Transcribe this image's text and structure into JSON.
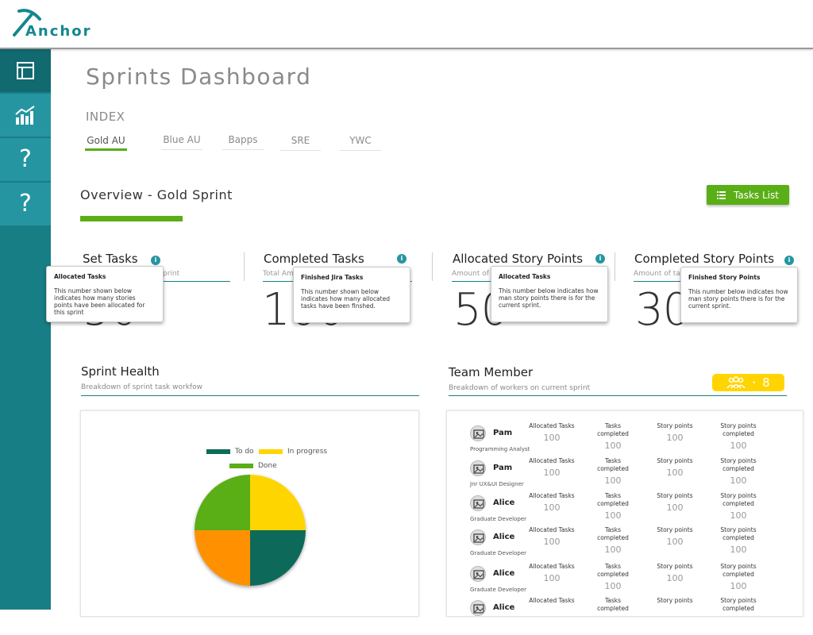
{
  "brand": {
    "name": "Anchor",
    "color": "#14878f"
  },
  "sidebar": {
    "items": [
      {
        "icon": "dashboard-icon",
        "active": true
      },
      {
        "icon": "bar-chart-icon",
        "active": false
      },
      {
        "icon": "help-icon",
        "label": "?"
      },
      {
        "icon": "help-icon",
        "label": "?"
      }
    ]
  },
  "page": {
    "title": "Sprints Dashboard"
  },
  "index": {
    "label": "INDEX",
    "tabs": [
      "Gold AU",
      "Blue AU",
      "Bapps",
      "SRE",
      "YWC"
    ],
    "active": "Gold AU"
  },
  "overview": {
    "title": "Overview - Gold Sprint",
    "tasks_button": "Tasks List"
  },
  "stats": [
    {
      "title": "Set Tasks",
      "sub": "print",
      "value": "50"
    },
    {
      "title": "Completed Tasks",
      "sub": "Total Am",
      "value": "100"
    },
    {
      "title": "Allocated Story Points",
      "sub": "Amount of",
      "value": "50"
    },
    {
      "title": "Completed Story Points",
      "sub": "Amount of ta",
      "value": "30"
    }
  ],
  "tooltips": [
    {
      "title": "Allocated Tasks",
      "body": "This number shown below indicates how many stories points have been allocated for this sprint"
    },
    {
      "title": "Finished Jira Tasks",
      "body": "This number shown below indicates how many allocated tasks have been finshed."
    },
    {
      "title": "Allocated Tasks",
      "body": "This number below indicates how man story points there is for the current sprint."
    },
    {
      "title": "Finished Story Points",
      "body": "This number below indicates how man story points there is for the current sprint."
    }
  ],
  "sprint_health": {
    "title": "Sprint Health",
    "subtitle": "Breakdown of sprint  task workfow",
    "legend": [
      {
        "label": "To do",
        "color": "#0e6b5a"
      },
      {
        "label": "In progress",
        "color": "#ffd500"
      },
      {
        "label": "Done",
        "color": "#5aae16"
      }
    ]
  },
  "chart_data": {
    "type": "pie",
    "slices": [
      {
        "label": "In progress",
        "value": 25,
        "color": "#ffd500"
      },
      {
        "label": "To do",
        "value": 25,
        "color": "#0e6b5a"
      },
      {
        "label": "",
        "value": 25,
        "color": "#ff9100"
      },
      {
        "label": "Done",
        "value": 25,
        "color": "#5aae16"
      }
    ],
    "legend_position": "top"
  },
  "team": {
    "title": "Team Member",
    "subtitle": "Breakdown of workers on current sprint",
    "count": "8",
    "columns": [
      "Allocated Tasks",
      "Tasks completed",
      "Story points",
      "Story points completed"
    ],
    "members": [
      {
        "name": "Pam",
        "role": "Programming Analyst",
        "values": [
          "100",
          "100",
          "100",
          "100"
        ]
      },
      {
        "name": "Pam",
        "role": "Jnr UX&UI Designer",
        "values": [
          "100",
          "100",
          "100",
          "100"
        ]
      },
      {
        "name": "Alice",
        "role": "Graduate Developer",
        "values": [
          "100",
          "100",
          "100",
          "100"
        ]
      },
      {
        "name": "Alice",
        "role": "Graduate Developer",
        "values": [
          "100",
          "100",
          "100",
          "100"
        ]
      },
      {
        "name": "Alice",
        "role": "Graduate Developer",
        "values": [
          "100",
          "100",
          "100",
          "100"
        ]
      },
      {
        "name": "Alice",
        "role": "",
        "values": [
          "",
          "",
          "",
          ""
        ]
      }
    ]
  },
  "colors": {
    "teal": "#187e85",
    "green": "#5aae16",
    "yellow": "#ffd400"
  }
}
